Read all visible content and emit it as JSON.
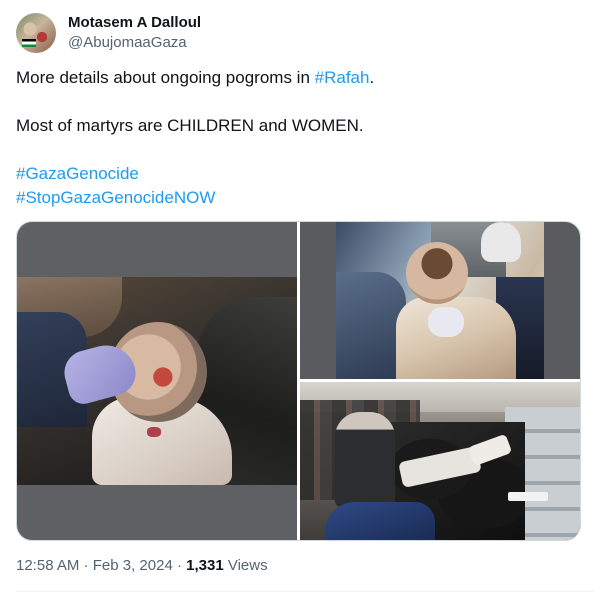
{
  "author": {
    "display_name": "Motasem A Dalloul",
    "handle": "@AbujomaaGaza"
  },
  "tweet": {
    "line1_prefix": "More details about ongoing pogroms in ",
    "line1_hashtag": "#Rafah",
    "line1_suffix": ".",
    "line2": "Most of martyrs are CHILDREN and WOMEN.",
    "hashtags": [
      "#GazaGenocide",
      "#StopGazaGenocideNOW"
    ]
  },
  "media": {
    "photo_count": 3
  },
  "meta": {
    "time": "12:58 AM",
    "separator": "·",
    "date": "Feb 3, 2024",
    "views_count": "1,331",
    "views_label": "Views"
  },
  "colors": {
    "link": "#1d9bf0",
    "text": "#0f1419",
    "secondary": "#536471"
  }
}
